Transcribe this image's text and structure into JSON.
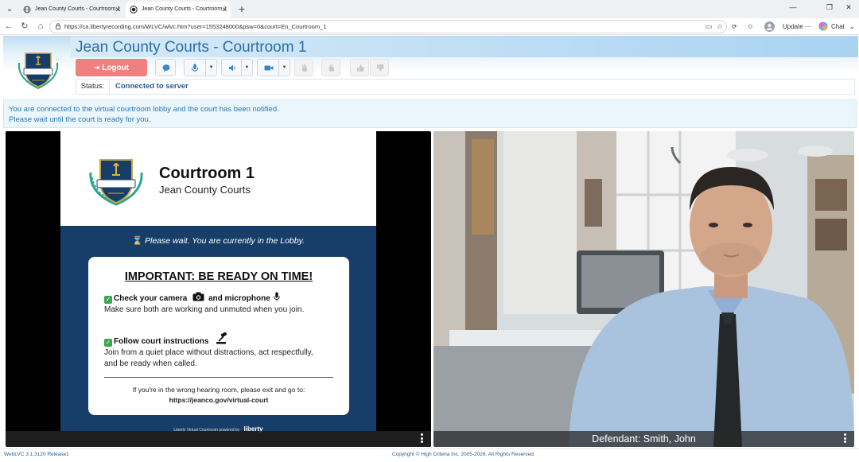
{
  "browser": {
    "tabs": [
      {
        "title": "Jean County Courts - Courtroom 1",
        "active": false
      },
      {
        "title": "Jean County Courts - Courtroom 1",
        "active": true
      }
    ],
    "url": "https://ca.libertyrecording.com/WLVC/wlvc.htm?user=1553248000&psw=0&court=En_Courtroom_1",
    "update_label": "Update",
    "chat_label": "Chat"
  },
  "app": {
    "title": "Jean County Courts - Courtroom 1",
    "logout_label": "Logout",
    "status_label": "Status:",
    "status_value": "Connected to server",
    "notice_line1": "You are connected to the virtual courtroom lobby and the court has been notified.",
    "notice_line2": "Please wait until the court is ready for you."
  },
  "slide": {
    "heading": "Courtroom 1",
    "subheading": "Jean County Courts",
    "lobby_text": "Please wait. You are currently in the Lobby.",
    "card_title": "IMPORTANT: BE READY ON TIME!",
    "camera_label": "Check your camera",
    "mic_label": "and microphone",
    "camera_text": "Make sure both are working and unmuted when you join.",
    "instructions_label": "Follow court instructions",
    "instructions_text_1": "Join from a quiet place without distractions, act respectfully,",
    "instructions_text_2": "and be ready when called.",
    "wrong_room_text": "If you're in the wrong hearing room, please exit and go to:",
    "wrong_room_url": "https://jeanco.gov/virtual-court",
    "powered_by": "Liberty Virtual Courtroom powered by",
    "powered_brand": "liberty",
    "logo_text": "Jean County Courts"
  },
  "participant": {
    "name": "Defendant: Smith, John"
  },
  "footer": {
    "version": "WebLVC 3.1.3120 Release1",
    "copyright": "Copyright © High Criteria Inc. 2005-2026. All Rights Reserved."
  },
  "colors": {
    "accent": "#2a6fa8",
    "logout": "#f08080",
    "slide_blue": "#163e68",
    "check_green": "#3aa74a"
  },
  "icons": [
    "chat-icon",
    "microphone-icon",
    "speaker-icon",
    "camera-icon",
    "hand-raise-icon",
    "thumbs-up-icon",
    "thumbs-down-icon",
    "logout-icon",
    "hourglass-icon",
    "gavel-icon"
  ]
}
